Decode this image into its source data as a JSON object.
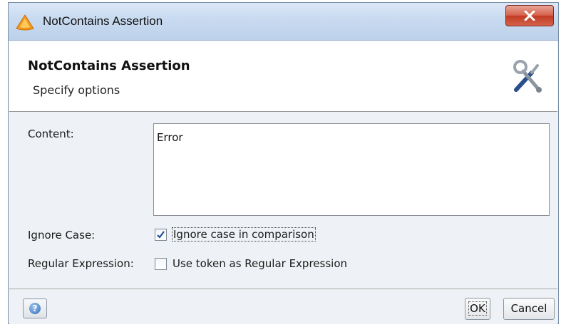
{
  "window": {
    "title": "NotContains Assertion",
    "app_icon": "orange-flame-icon",
    "close_icon": "close-icon"
  },
  "header": {
    "title": "NotContains Assertion",
    "subtitle": "Specify options",
    "icon": "tools-icon"
  },
  "form": {
    "content_label": "Content:",
    "content_value": "Error",
    "ignore_case_label": "Ignore Case:",
    "ignore_case_option": "Ignore case in comparison",
    "ignore_case_checked": true,
    "regex_label": "Regular Expression:",
    "regex_option": "Use token as Regular Expression",
    "regex_checked": false
  },
  "footer": {
    "help_icon": "help-icon",
    "help_glyph": "?",
    "ok_label": "OK",
    "cancel_label": "Cancel"
  },
  "colors": {
    "titlebar": "#c8daf0",
    "close_button": "#c23b24",
    "dialog_background": "#eef1f5"
  }
}
